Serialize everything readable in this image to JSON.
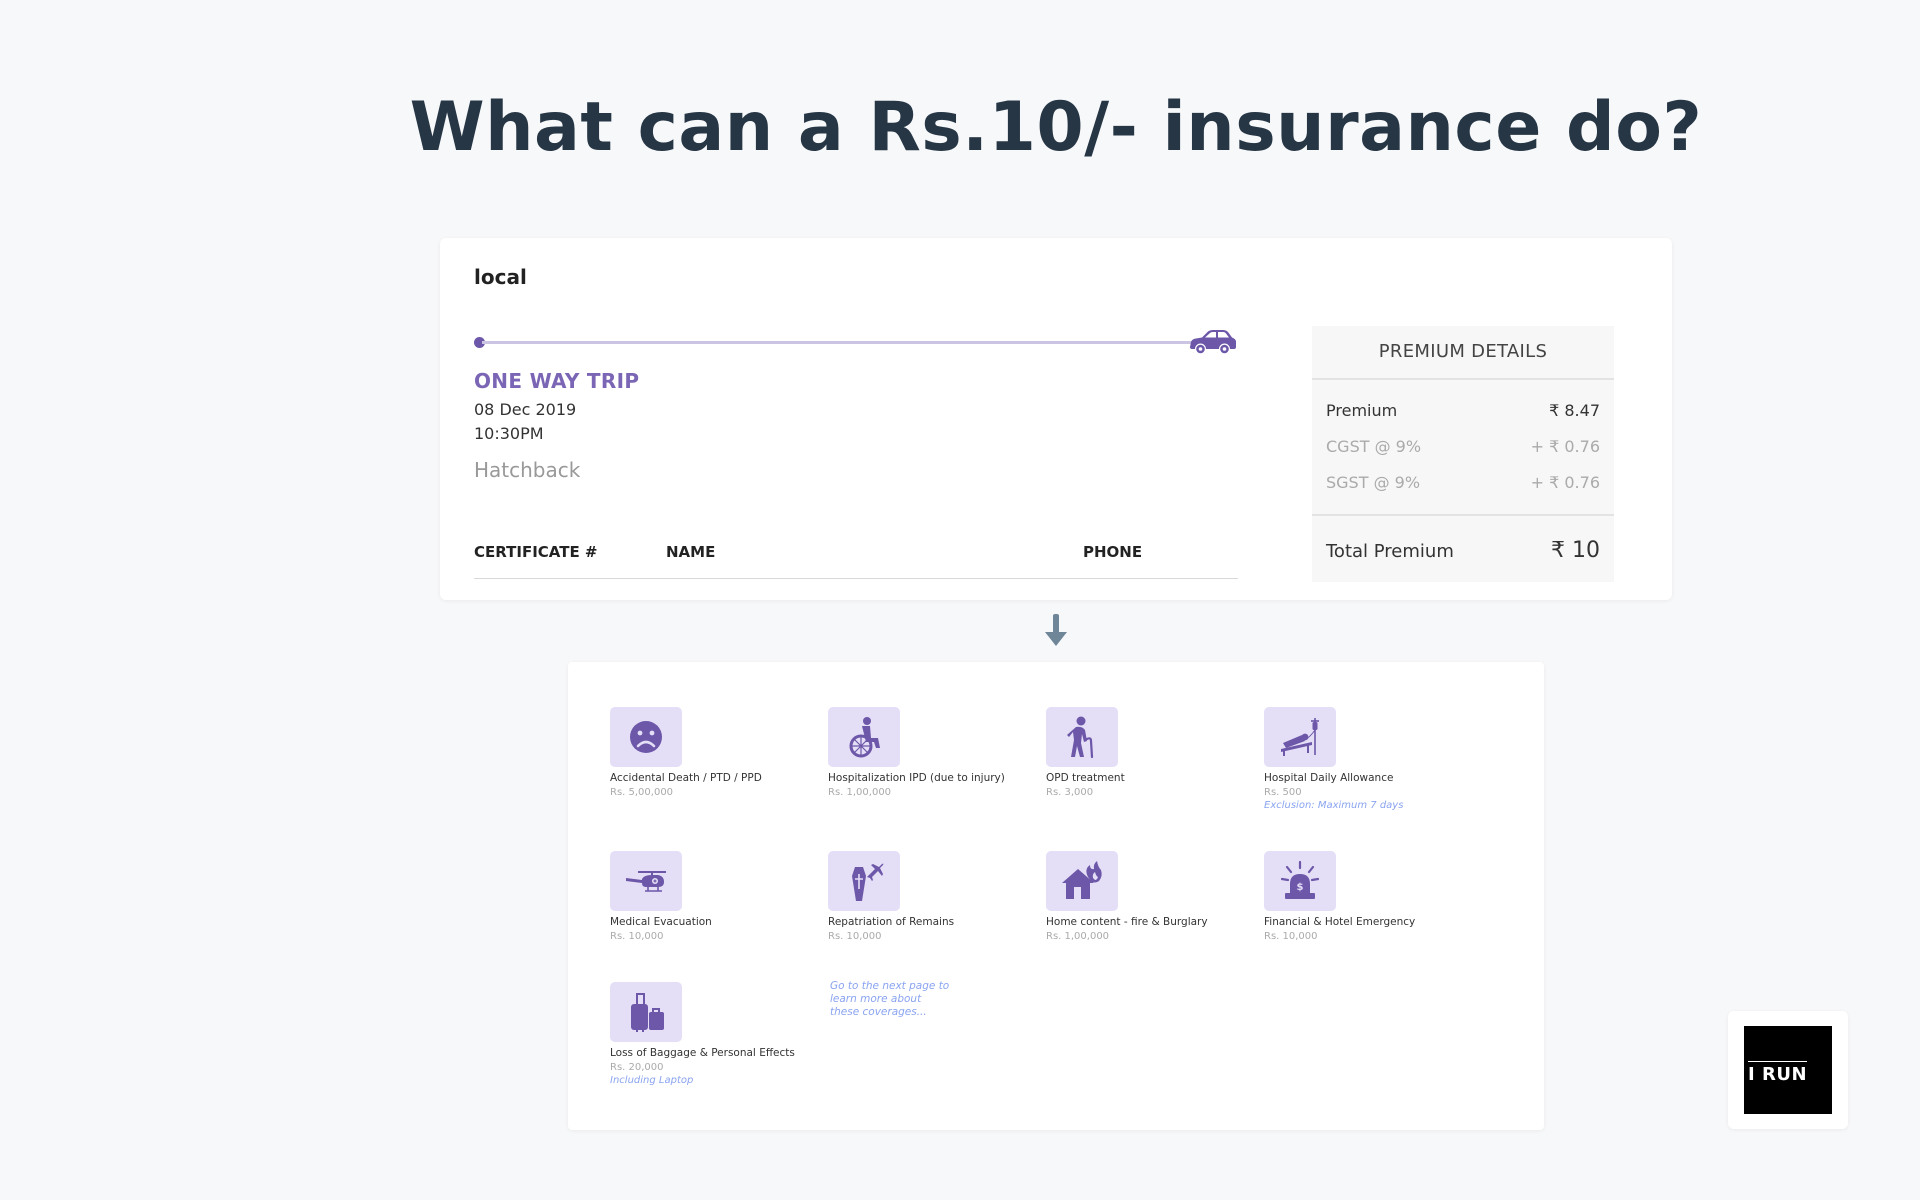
{
  "headline": "What can a Rs.10/- insurance do?",
  "ticket": {
    "trip_label": "local",
    "title": "ONE WAY TRIP",
    "date": "08 Dec 2019",
    "time": "10:30PM",
    "vehicle": "Hatchback",
    "columns": [
      "CERTIFICATE #",
      "NAME",
      "PHONE"
    ],
    "icon": "car-icon"
  },
  "premium": {
    "title": "PREMIUM DETAILS",
    "rows": [
      {
        "label": "Premium",
        "value": "₹ 8.47"
      },
      {
        "label": "CGST @ 9%",
        "value": "+ ₹ 0.76"
      },
      {
        "label": "SGST @ 9%",
        "value": "+ ₹ 0.76"
      }
    ],
    "total_label": "Total Premium",
    "total_value": "₹ 10"
  },
  "coverages": [
    {
      "name": "Accidental Death / PTD / PPD",
      "amount": "Rs. 5,00,000",
      "note": "",
      "icon": "sad-face-icon"
    },
    {
      "name": "Hospitalization IPD (due to injury)",
      "amount": "Rs. 1,00,000",
      "note": "",
      "icon": "wheelchair-icon"
    },
    {
      "name": "OPD treatment",
      "amount": "Rs. 3,000",
      "note": "",
      "icon": "elderly-person-icon"
    },
    {
      "name": "Hospital Daily Allowance",
      "amount": "Rs. 500",
      "note": "Exclusion: Maximum 7 days",
      "icon": "hospital-bed-icon"
    },
    {
      "name": "Medical Evacuation",
      "amount": "Rs. 10,000",
      "note": "",
      "icon": "helicopter-icon"
    },
    {
      "name": "Repatriation of Remains",
      "amount": "Rs. 10,000",
      "note": "",
      "icon": "coffin-plane-icon"
    },
    {
      "name": "Home content - fire & Burglary",
      "amount": "Rs. 1,00,000",
      "note": "",
      "icon": "house-fire-icon"
    },
    {
      "name": "Financial & Hotel Emergency",
      "amount": "Rs. 10,000",
      "note": "",
      "icon": "emergency-siren-icon"
    },
    {
      "name": "Loss of Baggage & Personal Effects",
      "amount": "Rs. 20,000",
      "note": "Including Laptop",
      "icon": "luggage-icon"
    }
  ],
  "next_note": "Go to the next page to learn more about these coverages...",
  "logo_text": "I RUN",
  "colors": {
    "accent": "#7b65b5",
    "icon_bg": "#e4def7",
    "icon_fg": "#6c57a8",
    "note": "#8aa4f0",
    "headline": "#263645"
  }
}
